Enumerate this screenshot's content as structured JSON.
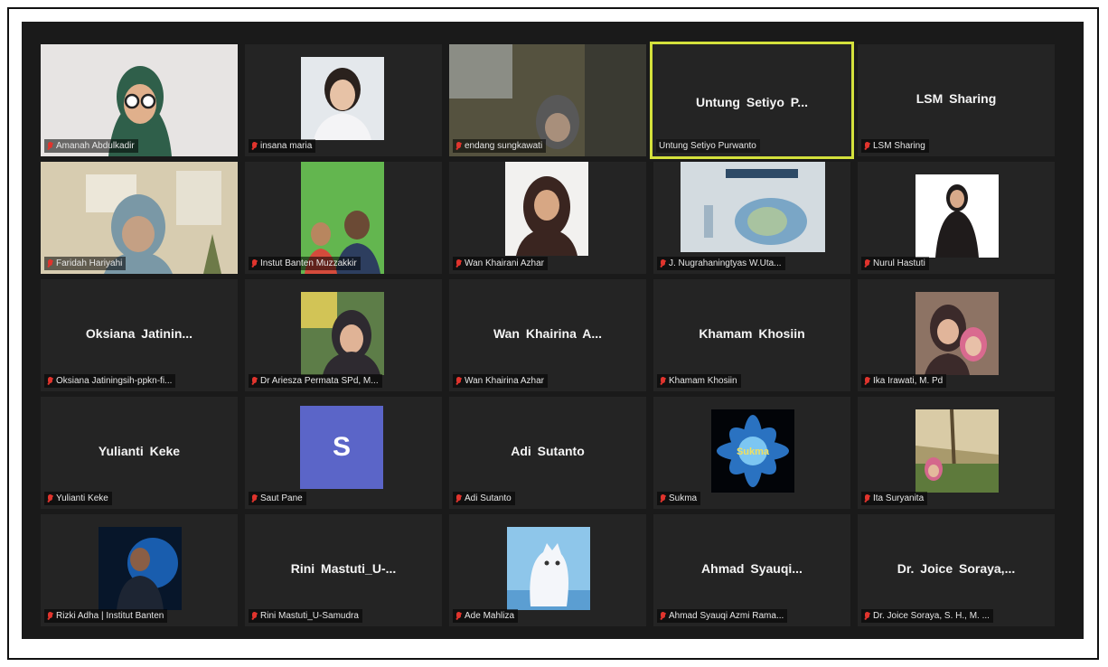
{
  "meeting": {
    "participants": [
      {
        "tile_name": "",
        "label": "Amanah Abdulkadir",
        "muted": true,
        "has_video": true
      },
      {
        "tile_name": "",
        "label": "insana maria",
        "muted": true,
        "has_video": true
      },
      {
        "tile_name": "",
        "label": "endang sungkawati",
        "muted": true,
        "has_video": true
      },
      {
        "tile_name": "Untung Setiyo P...",
        "label": "Untung Setiyo Purwanto",
        "muted": false,
        "has_video": false,
        "active_speaker": true
      },
      {
        "tile_name": "LSM Sharing",
        "label": "LSM Sharing",
        "muted": true,
        "has_video": false
      },
      {
        "tile_name": "",
        "label": "Faridah Hariyahi",
        "muted": true,
        "has_video": true
      },
      {
        "tile_name": "",
        "label": "Instut Banten Muzzakkir",
        "muted": true,
        "has_video": true
      },
      {
        "tile_name": "",
        "label": "Wan Khairani Azhar",
        "muted": true,
        "has_video": true
      },
      {
        "tile_name": "",
        "label": "J. Nugrahaningtyas W.Uta...",
        "muted": true,
        "has_video": true
      },
      {
        "tile_name": "",
        "label": "Nurul Hastuti",
        "muted": true,
        "has_video": true
      },
      {
        "tile_name": "Oksiana Jatinin...",
        "label": "Oksiana Jatiningsih-ppkn-fi...",
        "muted": true,
        "has_video": false
      },
      {
        "tile_name": "",
        "label": "Dr Ariesza Permata SPd, M...",
        "muted": true,
        "has_video": true
      },
      {
        "tile_name": "Wan Khairina A...",
        "label": "Wan Khairina Azhar",
        "muted": true,
        "has_video": false
      },
      {
        "tile_name": "Khamam Khosiin",
        "label": "Khamam Khosiin",
        "muted": true,
        "has_video": false
      },
      {
        "tile_name": "",
        "label": "Ika Irawati, M. Pd",
        "muted": true,
        "has_video": true
      },
      {
        "tile_name": "Yulianti Keke",
        "label": "Yulianti Keke",
        "muted": true,
        "has_video": false
      },
      {
        "tile_name": "",
        "label": "Saut Pane",
        "muted": true,
        "has_video": false,
        "avatar_letter": "S"
      },
      {
        "tile_name": "Adi Sutanto",
        "label": "Adi Sutanto",
        "muted": true,
        "has_video": false
      },
      {
        "tile_name": "",
        "label": "Sukma",
        "muted": true,
        "has_video": true,
        "avatar_text": "Sukma"
      },
      {
        "tile_name": "",
        "label": "Ita Suryanita",
        "muted": true,
        "has_video": true
      },
      {
        "tile_name": "",
        "label": "Rizki Adha | Institut Banten",
        "muted": true,
        "has_video": true
      },
      {
        "tile_name": "Rini Mastuti_U-...",
        "label": "Rini Mastuti_U-Samudra",
        "muted": true,
        "has_video": false
      },
      {
        "tile_name": "",
        "label": "Ade Mahliza",
        "muted": true,
        "has_video": true
      },
      {
        "tile_name": "Ahmad Syauqi...",
        "label": "Ahmad Syauqi Azmi Rama...",
        "muted": true,
        "has_video": false
      },
      {
        "tile_name": "Dr. Joice Soraya,...",
        "label": "Dr. Joice Soraya, S. H., M. ...",
        "muted": true,
        "has_video": false
      }
    ]
  },
  "colors": {
    "active_border": "#d4e13c",
    "muted_icon": "#e0342d",
    "avatar_bg": "#5b65c8"
  }
}
